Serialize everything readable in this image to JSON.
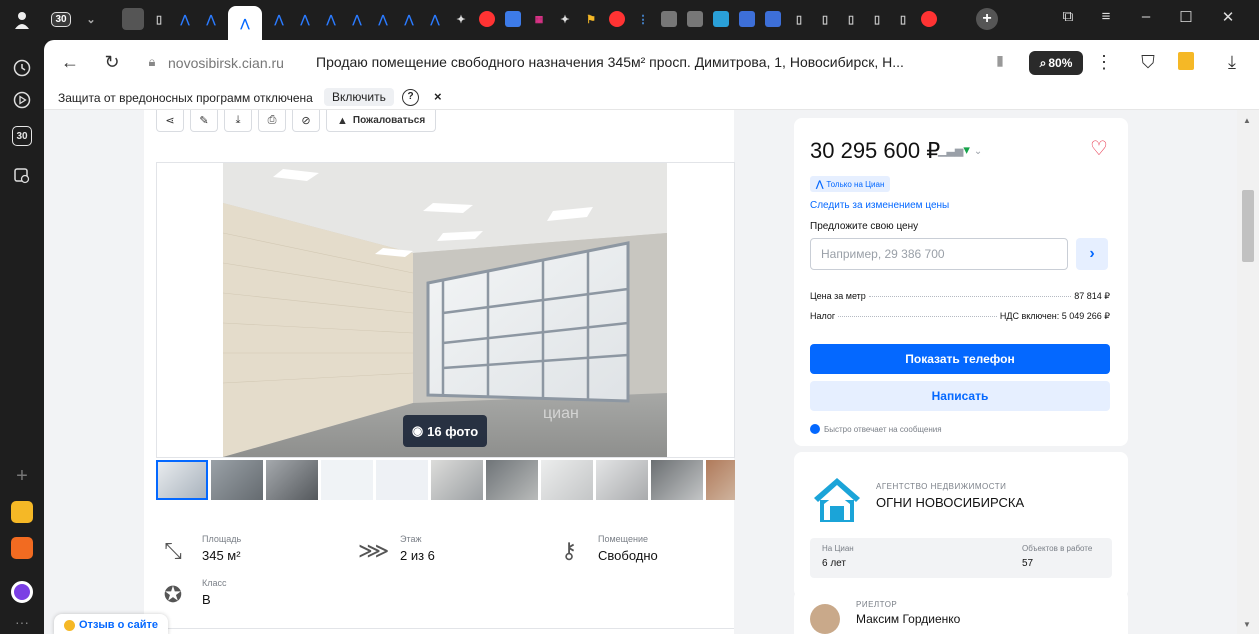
{
  "sidebar": {
    "tab_count": "30"
  },
  "tabs": [
    {
      "icon": "profile-icon"
    },
    {
      "icon": "tab-counter",
      "label": "30"
    },
    {
      "icon": "chevron-down-icon"
    },
    {
      "icon": "site-icon"
    },
    {
      "icon": "page-icon"
    },
    {
      "icon": "cian-icon"
    },
    {
      "icon": "cian-icon"
    },
    {
      "icon": "cian-icon",
      "active": true
    },
    {
      "icon": "cian-icon"
    },
    {
      "icon": "cian-icon"
    },
    {
      "icon": "cian-icon"
    },
    {
      "icon": "cian-icon"
    },
    {
      "icon": "cian-icon"
    },
    {
      "icon": "cian-icon"
    },
    {
      "icon": "cian-icon"
    },
    {
      "icon": "sparkle-icon"
    },
    {
      "icon": "yandex-icon"
    },
    {
      "icon": "cube-icon"
    },
    {
      "icon": "ozon-icon"
    },
    {
      "icon": "sparkle-icon"
    },
    {
      "icon": "award-icon"
    },
    {
      "icon": "yandex-icon"
    },
    {
      "icon": "chart-icon"
    },
    {
      "icon": "camera-icon"
    },
    {
      "icon": "camera-icon"
    },
    {
      "icon": "camera-icon"
    },
    {
      "icon": "mail-icon"
    },
    {
      "icon": "mail-icon"
    },
    {
      "icon": "page-icon"
    },
    {
      "icon": "page-icon"
    },
    {
      "icon": "page-icon"
    },
    {
      "icon": "page-icon"
    },
    {
      "icon": "page-icon"
    },
    {
      "icon": "yandex-icon"
    }
  ],
  "address_bar": {
    "domain": "novosibirsk.cian.ru",
    "title": "Продаю помещение свободного назначения 345м² просп. Димитрова, 1, Новосибирск, Н...",
    "zoom": "80%"
  },
  "infobar": {
    "message": "Защита от вредоносных программ отключена",
    "enable_label": "Включить",
    "help": "?",
    "close": "×"
  },
  "toolbar": {
    "complain_label": "Пожаловаться"
  },
  "gallery": {
    "photo_count_label": "16 фото",
    "watermark": "циан"
  },
  "specs": [
    {
      "label": "Площадь",
      "value": "345 м²",
      "icon": "area-icon"
    },
    {
      "label": "Этаж",
      "value": "2 из 6",
      "icon": "stairs-icon"
    },
    {
      "label": "Помещение",
      "value": "Свободно",
      "icon": "key-icon"
    },
    {
      "label": "Класс",
      "value": "B",
      "icon": "star-icon"
    }
  ],
  "review": {
    "label": "Отзыв о сайте"
  },
  "price_card": {
    "price": "30 295 600 ₽",
    "only_badge": "Только на Циан",
    "follow_label": "Следить за изменением цены",
    "offer_label": "Предложите свою цену",
    "offer_placeholder": "Например, 29 386 700",
    "price_per_meter_label": "Цена за метр",
    "price_per_meter_value": "87 814 ₽",
    "tax_label": "Налог",
    "tax_value": "НДС включен: 5 049 266 ₽",
    "phone_button": "Показать телефон",
    "write_button": "Написать",
    "fast_reply": "Быстро отвечает на сообщения"
  },
  "agency": {
    "kind": "АГЕНТСТВО НЕДВИЖИМОСТИ",
    "name": "ОГНИ НОВОСИБИРСКА",
    "on_cian_label": "На Циан",
    "on_cian_value": "6 лет",
    "objects_label": "Объектов в работе",
    "objects_value": "57"
  },
  "realtor": {
    "kind": "РИЕЛТОР",
    "name": "Максим Гордиенко"
  },
  "colors": {
    "accent": "#0468ff",
    "accent_light": "#e6efff",
    "heart": "#e8334a",
    "page_bg": "#f2f3f5"
  }
}
